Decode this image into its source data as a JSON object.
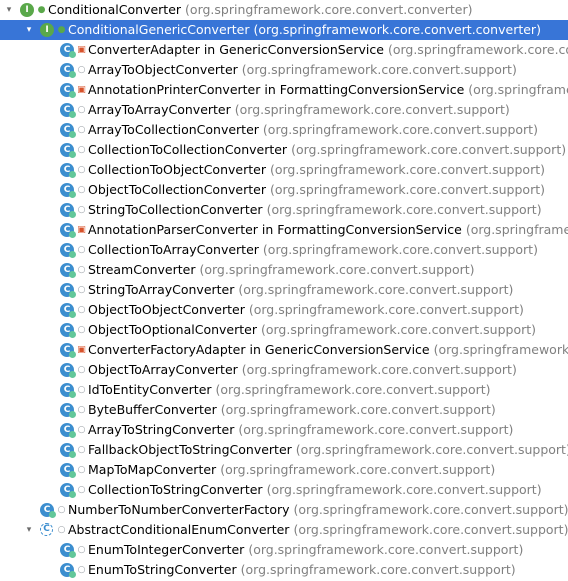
{
  "rows": [
    {
      "level": 0,
      "arrow": "expanded",
      "icon": "interface",
      "visibility": "public",
      "name": "ConditionalConverter",
      "package": "(org.springframework.core.convert.converter)",
      "selected": false
    },
    {
      "level": 1,
      "arrow": "expanded",
      "icon": "interface",
      "visibility": "public",
      "name": "ConditionalGenericConverter",
      "package": "(org.springframework.core.convert.converter)",
      "selected": true
    },
    {
      "level": 2,
      "arrow": "none",
      "icon": "class",
      "visibility": "private",
      "name": "ConverterAdapter in GenericConversionService",
      "package": "(org.springframework.core.convert.support)",
      "selected": false
    },
    {
      "level": 2,
      "arrow": "none",
      "icon": "class",
      "visibility": "package",
      "name": "ArrayToObjectConverter",
      "package": "(org.springframework.core.convert.support)",
      "selected": false
    },
    {
      "level": 2,
      "arrow": "none",
      "icon": "class",
      "visibility": "private",
      "name": "AnnotationPrinterConverter in FormattingConversionService",
      "package": "(org.springframework.format.support)",
      "selected": false
    },
    {
      "level": 2,
      "arrow": "none",
      "icon": "class",
      "visibility": "package",
      "name": "ArrayToArrayConverter",
      "package": "(org.springframework.core.convert.support)",
      "selected": false
    },
    {
      "level": 2,
      "arrow": "none",
      "icon": "class",
      "visibility": "package",
      "name": "ArrayToCollectionConverter",
      "package": "(org.springframework.core.convert.support)",
      "selected": false
    },
    {
      "level": 2,
      "arrow": "none",
      "icon": "class",
      "visibility": "package",
      "name": "CollectionToCollectionConverter",
      "package": "(org.springframework.core.convert.support)",
      "selected": false
    },
    {
      "level": 2,
      "arrow": "none",
      "icon": "class",
      "visibility": "package",
      "name": "CollectionToObjectConverter",
      "package": "(org.springframework.core.convert.support)",
      "selected": false
    },
    {
      "level": 2,
      "arrow": "none",
      "icon": "class",
      "visibility": "package",
      "name": "ObjectToCollectionConverter",
      "package": "(org.springframework.core.convert.support)",
      "selected": false
    },
    {
      "level": 2,
      "arrow": "none",
      "icon": "class",
      "visibility": "package",
      "name": "StringToCollectionConverter",
      "package": "(org.springframework.core.convert.support)",
      "selected": false
    },
    {
      "level": 2,
      "arrow": "none",
      "icon": "class",
      "visibility": "private",
      "name": "AnnotationParserConverter in FormattingConversionService",
      "package": "(org.springframework.format.support)",
      "selected": false
    },
    {
      "level": 2,
      "arrow": "none",
      "icon": "class",
      "visibility": "package",
      "name": "CollectionToArrayConverter",
      "package": "(org.springframework.core.convert.support)",
      "selected": false
    },
    {
      "level": 2,
      "arrow": "none",
      "icon": "class",
      "visibility": "package",
      "name": "StreamConverter",
      "package": "(org.springframework.core.convert.support)",
      "selected": false
    },
    {
      "level": 2,
      "arrow": "none",
      "icon": "class",
      "visibility": "package",
      "name": "StringToArrayConverter",
      "package": "(org.springframework.core.convert.support)",
      "selected": false
    },
    {
      "level": 2,
      "arrow": "none",
      "icon": "class",
      "visibility": "package",
      "name": "ObjectToObjectConverter",
      "package": "(org.springframework.core.convert.support)",
      "selected": false
    },
    {
      "level": 2,
      "arrow": "none",
      "icon": "class",
      "visibility": "package",
      "name": "ObjectToOptionalConverter",
      "package": "(org.springframework.core.convert.support)",
      "selected": false
    },
    {
      "level": 2,
      "arrow": "none",
      "icon": "class",
      "visibility": "private",
      "name": "ConverterFactoryAdapter in GenericConversionService",
      "package": "(org.springframework.core.convert.support)",
      "selected": false
    },
    {
      "level": 2,
      "arrow": "none",
      "icon": "class",
      "visibility": "package",
      "name": "ObjectToArrayConverter",
      "package": "(org.springframework.core.convert.support)",
      "selected": false
    },
    {
      "level": 2,
      "arrow": "none",
      "icon": "class",
      "visibility": "package",
      "name": "IdToEntityConverter",
      "package": "(org.springframework.core.convert.support)",
      "selected": false
    },
    {
      "level": 2,
      "arrow": "none",
      "icon": "class",
      "visibility": "package",
      "name": "ByteBufferConverter",
      "package": "(org.springframework.core.convert.support)",
      "selected": false
    },
    {
      "level": 2,
      "arrow": "none",
      "icon": "class",
      "visibility": "package",
      "name": "ArrayToStringConverter",
      "package": "(org.springframework.core.convert.support)",
      "selected": false
    },
    {
      "level": 2,
      "arrow": "none",
      "icon": "class",
      "visibility": "package",
      "name": "FallbackObjectToStringConverter",
      "package": "(org.springframework.core.convert.support)",
      "selected": false
    },
    {
      "level": 2,
      "arrow": "none",
      "icon": "class",
      "visibility": "package",
      "name": "MapToMapConverter",
      "package": "(org.springframework.core.convert.support)",
      "selected": false
    },
    {
      "level": 2,
      "arrow": "none",
      "icon": "class",
      "visibility": "package",
      "name": "CollectionToStringConverter",
      "package": "(org.springframework.core.convert.support)",
      "selected": false
    },
    {
      "level": 1,
      "arrow": "none",
      "icon": "class",
      "visibility": "package",
      "name": "NumberToNumberConverterFactory",
      "package": "(org.springframework.core.convert.support)",
      "selected": false
    },
    {
      "level": 1,
      "arrow": "expanded",
      "icon": "abstract",
      "visibility": "package",
      "name": "AbstractConditionalEnumConverter",
      "package": "(org.springframework.core.convert.support)",
      "selected": false
    },
    {
      "level": 2,
      "arrow": "none",
      "icon": "class",
      "visibility": "package",
      "name": "EnumToIntegerConverter",
      "package": "(org.springframework.core.convert.support)",
      "selected": false
    },
    {
      "level": 2,
      "arrow": "none",
      "icon": "class",
      "visibility": "package",
      "name": "EnumToStringConverter",
      "package": "(org.springframework.core.convert.support)",
      "selected": false
    }
  ],
  "colors": {
    "selection": "#3875d7",
    "class_icon": "#3c8ecf",
    "interface_icon": "#5aa84a",
    "private_lock": "#d8522b",
    "package_text": "#808080"
  }
}
